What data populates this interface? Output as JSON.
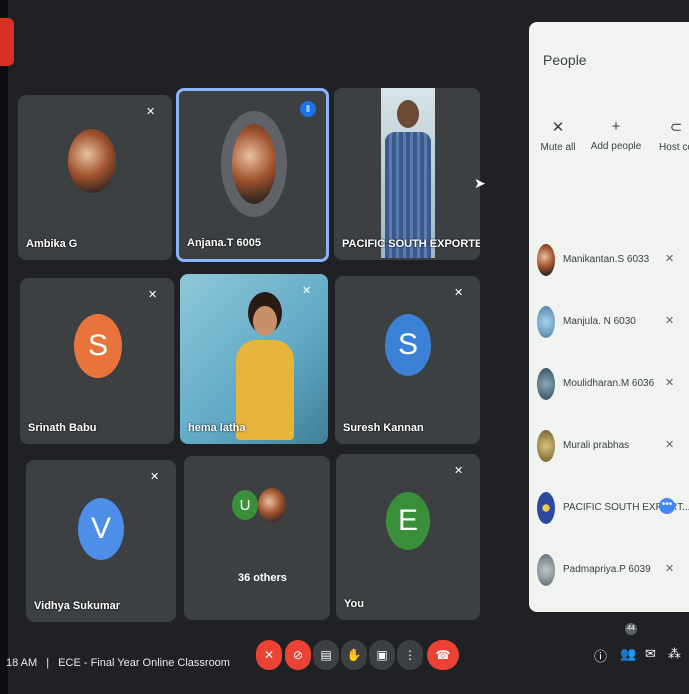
{
  "tiles": [
    {
      "name": "Ambika G",
      "avatar": "photo",
      "muted": true
    },
    {
      "name": "Anjana.T 6005",
      "avatar": "photo",
      "speaking": true
    },
    {
      "name": "PACIFIC SOUTH EXPORTERS",
      "avatar": "video"
    },
    {
      "name": "Srinath Babu",
      "initial": "S",
      "color": "#e8743b",
      "muted": true
    },
    {
      "name": "hema latha",
      "avatar": "video",
      "muted": true
    },
    {
      "name": "Suresh Kannan",
      "initial": "S",
      "color": "#3b82d6",
      "muted": true
    },
    {
      "name": "Vidhya Sukumar",
      "initial": "V",
      "color": "#4c8ee8",
      "muted": true
    },
    {
      "name": "36 others",
      "initial": "U",
      "color": "#3a8f3a"
    },
    {
      "name": "You",
      "initial": "E",
      "color": "#3a8f3a",
      "muted": true
    }
  ],
  "people_panel": {
    "title": "People",
    "actions": [
      "Mute all",
      "Add people",
      "Host co"
    ],
    "participants": [
      {
        "name": "Manikantan.S 6033"
      },
      {
        "name": "Manjula. N 6030"
      },
      {
        "name": "Moulidharan.M 6036"
      },
      {
        "name": "Murali prabhas"
      },
      {
        "name": "PACIFIC SOUTH EXPORT...",
        "more": true
      },
      {
        "name": "Padmapriya.P 6039"
      }
    ]
  },
  "bottom": {
    "time": "18 AM",
    "separator": "|",
    "meeting": "ECE - Final Year Online Classroom",
    "people_count": "44"
  },
  "colors": {
    "accent": "#8ab4f8",
    "danger": "#ea4335",
    "tile": "#3c4043"
  }
}
